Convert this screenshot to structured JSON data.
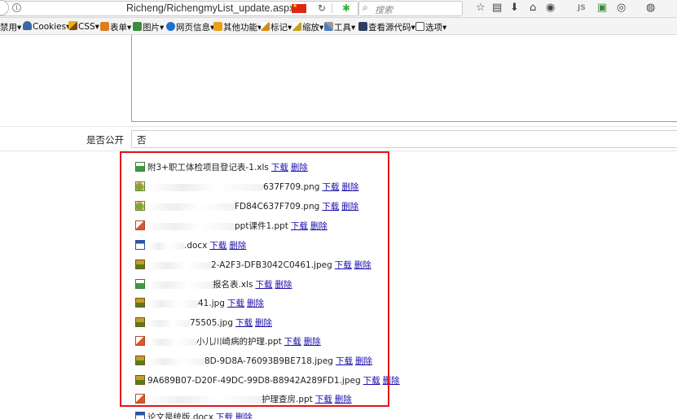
{
  "browser": {
    "url": "Richeng/RichengmyList_update.aspx?",
    "search_placeholder": "搜索",
    "toolbar_js": "JS",
    "toolbar": [
      {
        "label": "禁用▾"
      },
      {
        "label": "Cookies▾"
      },
      {
        "label": "CSS▾"
      },
      {
        "label": "表单▾"
      },
      {
        "label": "图片▾"
      },
      {
        "label": "网页信息▾"
      },
      {
        "label": "其他功能▾"
      },
      {
        "label": "标记▾"
      },
      {
        "label": "缩放▾"
      },
      {
        "label": "工具▾"
      },
      {
        "label": "查看源代码▾"
      },
      {
        "label": "选项▾"
      }
    ]
  },
  "form": {
    "public_label": "是否公开",
    "public_value": "否"
  },
  "attachments": [
    {
      "name": "附3+职工体检项目登记表-1.xls",
      "icon": "xls-file-icon"
    },
    {
      "name": "637F709.png",
      "icon": "png-file-icon"
    },
    {
      "name": "FD84C637F709.png",
      "icon": "png-file-icon"
    },
    {
      "name": "ppt课件1.ppt",
      "icon": "ppt-file-icon"
    },
    {
      "name": ".docx",
      "icon": "docx-file-icon"
    },
    {
      "name": "2-A2F3-DFB3042C0461.jpeg",
      "icon": "jpeg-file-icon"
    },
    {
      "name": "报名表.xls",
      "icon": "xls-file-icon"
    },
    {
      "name": "41.jpg",
      "icon": "jpeg-file-icon"
    },
    {
      "name": "75505.jpg",
      "icon": "jpeg-file-icon"
    },
    {
      "name": "小儿川崎病的护理.ppt",
      "icon": "ppt-file-icon"
    },
    {
      "name": "8D-9D8A-76093B9BE718.jpeg",
      "icon": "jpeg-file-icon"
    },
    {
      "name": "9A689B07-D20F-49DC-99D8-B8942A289FD1.jpeg",
      "icon": "jpeg-file-icon"
    },
    {
      "name": "护理查房.ppt",
      "icon": "ppt-file-icon"
    },
    {
      "name": "论文是统版.docx",
      "icon": "docx-file-icon"
    }
  ],
  "actions": {
    "download": "下载",
    "delete": "删除"
  },
  "colors": {
    "highlight": "#e4141b",
    "link": "#1a0dab"
  }
}
